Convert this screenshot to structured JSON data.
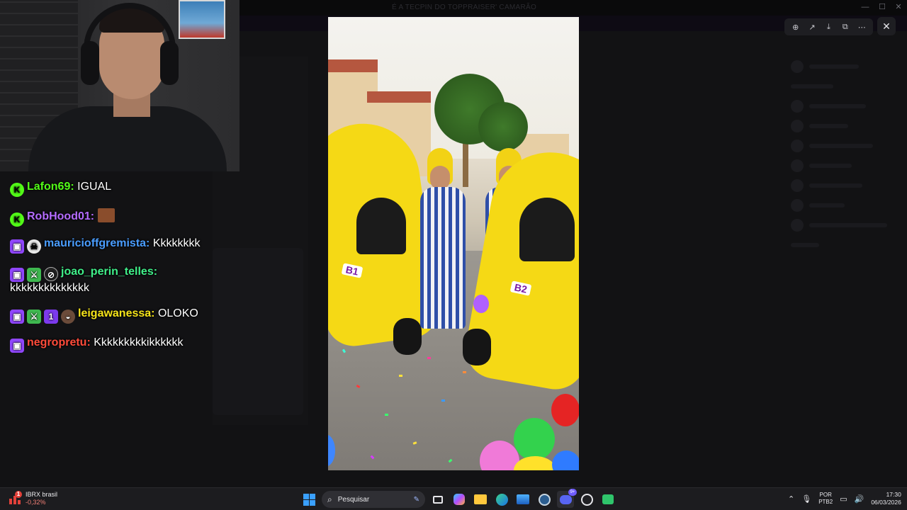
{
  "window": {
    "title": "É A TECPIN DO TOPPRAISER' CAMARÃO",
    "controls": {
      "minimize": "—",
      "maximize": "☐",
      "close": "✕"
    }
  },
  "chat": {
    "messages": [
      {
        "badges": [
          "kick-icon"
        ],
        "user": "Lafon69:",
        "user_color": "#53fc18",
        "text": "IGUAL"
      },
      {
        "badges": [
          "kick-icon"
        ],
        "user": "RobHood01:",
        "user_color": "#b56cff",
        "text": ""
      },
      {
        "badges": [
          "twitch-icon",
          "skull-icon"
        ],
        "user": "mauricioffgremista:",
        "user_color": "#4a9dff",
        "text": "Kkkkkkkk"
      },
      {
        "badges": [
          "twitch-icon",
          "sword-icon",
          "eye-slash-icon"
        ],
        "user": "joao_perin_telles:",
        "user_color": "#40f08a",
        "text": "kkkkkkkkkkkkkk"
      },
      {
        "badges": [
          "twitch-icon",
          "sword-icon",
          "first-icon",
          "bowl-icon"
        ],
        "user": "leigawanessa:",
        "user_color": "#f5e31a",
        "text": "OLOKO"
      },
      {
        "badges": [
          "twitch-icon"
        ],
        "user": "negropretu:",
        "user_color": "#ff4b3a",
        "text": "Kkkkkkkkkikkkkkk"
      }
    ]
  },
  "viewer": {
    "plate_left": "B1",
    "plate_right": "B2",
    "toolbar": [
      "zoom-in-icon",
      "share-icon",
      "download-icon",
      "open-external-icon",
      "more-icon"
    ],
    "close_label": "✕"
  },
  "taskbar": {
    "stock_name": "IBRX brasil",
    "stock_change": "-0,32%",
    "stock_alert": "1",
    "search_placeholder": "Pesquisar",
    "discord_badge": "9+",
    "lang_top": "POR",
    "lang_bottom": "PTB2",
    "time": "17:30",
    "date": "06/03/2026"
  }
}
